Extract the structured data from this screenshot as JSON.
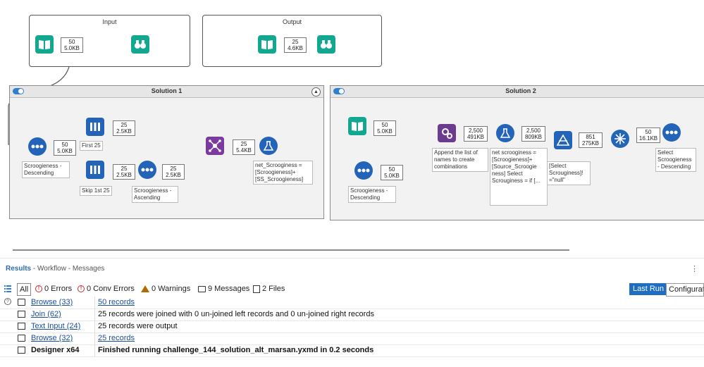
{
  "canvas": {
    "input_container": {
      "title": "Input",
      "badge_count": "50",
      "badge_size": "5.0KB"
    },
    "output_container": {
      "title": "Output",
      "badge_count": "25",
      "badge_size": "4.6KB"
    },
    "solution1": {
      "title": "Solution 1",
      "sort_badge_count": "50",
      "sort_badge_size": "5.0KB",
      "sort_note": "Scroogieness - Descending",
      "first_badge_count": "25",
      "first_badge_size": "2.5KB",
      "first_note": "First 25",
      "skip_badge_count": "25",
      "skip_badge_size": "2.5KB",
      "skip_note": "Skip 1st 25",
      "asc_badge_count": "25",
      "asc_badge_size": "2.5KB",
      "asc_note": "Scroogieness - Ascending",
      "join_badge_count": "25",
      "join_badge_size": "5.4KB",
      "formula_note": "net_Scrooginess = [Scroogieness]+ [SS_Scroogieness]"
    },
    "solution2": {
      "title": "Solution 2",
      "input_badge_count": "50",
      "input_badge_size": "5.0KB",
      "sort_badge_count": "50",
      "sort_badge_size": "5.0KB",
      "sort_note": "Scroogieness - Descending",
      "append_badge_count": "2,500",
      "append_badge_size": "491KB",
      "append_note": "Append the list of names to create combinations",
      "formula_badge_count": "2,500",
      "formula_badge_size": "809KB",
      "formula_note": "net scrooginess = [Scroogieness]+ [Source_Scroogie ness] Select Scrouginess = if [...",
      "filter_badge_count": "851",
      "filter_badge_size": "275KB",
      "filter_note": "[Select Scrouginess]! =\"null\"",
      "unique_badge_count": "50",
      "unique_badge_size": "16.1KB",
      "final_note": "Select Scroogieness - Descending"
    }
  },
  "results": {
    "title": "Results",
    "subtitle": " - Workflow - Messages",
    "filters": {
      "all": "All",
      "errors": "0 Errors",
      "conv_errors": "0 Conv Errors",
      "warnings": "0 Warnings",
      "messages": "9 Messages",
      "files": "2 Files"
    },
    "last_run": "Last Run",
    "configuration": "Configurati",
    "rows": [
      {
        "tool": "Browse (33)",
        "message": "50 records"
      },
      {
        "tool": "Join (62)",
        "message": "25 records were joined with 0 un-joined left records and 0 un-joined right records"
      },
      {
        "tool": "Text Input (24)",
        "message": "25 records were output"
      },
      {
        "tool": "Browse (32)",
        "message": "25 records"
      },
      {
        "tool": "Designer x64",
        "message": "Finished running challenge_144_solution_alt_marsan.yxmd in 0.2 seconds"
      }
    ]
  },
  "colors": {
    "accent": "#1f6ec2",
    "tool_green": "#12a88f",
    "tool_blue": "#2364b8",
    "tool_purple": "#7a3a9e"
  }
}
